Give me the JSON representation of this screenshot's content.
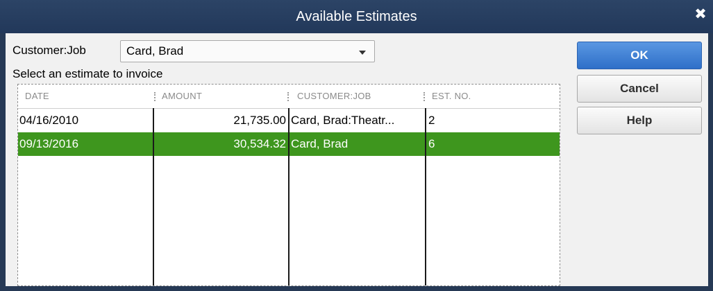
{
  "window": {
    "title": "Available Estimates",
    "close_glyph": "✖"
  },
  "form": {
    "customer_job_label": "Customer:Job",
    "customer_job_value": "Card, Brad",
    "instruction": "Select an estimate to invoice"
  },
  "table": {
    "columns": [
      "DATE",
      "AMOUNT",
      "CUSTOMER:JOB",
      "EST. NO."
    ],
    "rows": [
      {
        "date": "04/16/2010",
        "amount": "21,735.00",
        "customer_job": "Card, Brad:Theatr...",
        "est_no": "2"
      },
      {
        "date": "09/13/2016",
        "amount": "30,534.32",
        "customer_job": "Card, Brad",
        "est_no": "6"
      }
    ],
    "selected_row_color": "#3e961e"
  },
  "buttons": {
    "ok": "OK",
    "cancel": "Cancel",
    "help": "Help"
  },
  "icons": {
    "close": "close-icon",
    "dropdown": "chevron-down-icon"
  }
}
